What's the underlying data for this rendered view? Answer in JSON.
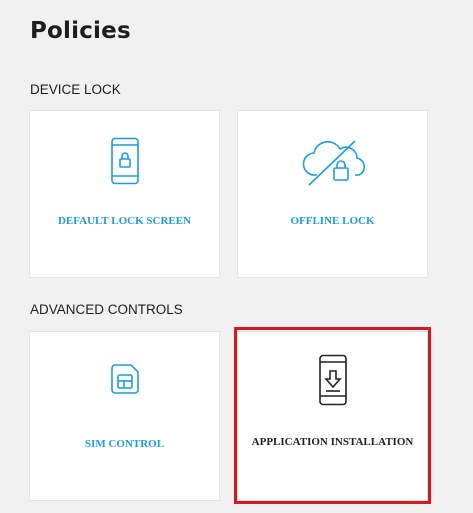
{
  "page": {
    "title": "Policies"
  },
  "sections": [
    {
      "title": "DEVICE LOCK",
      "tiles": [
        {
          "label": "DEFAULT LOCK SCREEN",
          "icon": "phone-lock-icon",
          "color": "#1c9be6"
        },
        {
          "label": "OFFLINE LOCK",
          "icon": "cloud-offline-lock-icon",
          "color": "#1c9be6"
        }
      ]
    },
    {
      "title": "ADVANCED CONTROLS",
      "tiles": [
        {
          "label": "SIM CONTROL",
          "icon": "sim-card-icon",
          "color": "#1c9be6"
        },
        {
          "label": "APPLICATION INSTALLATION",
          "icon": "phone-download-icon",
          "color": "#222222",
          "selected": true
        }
      ]
    }
  ],
  "colors": {
    "accent": "#1c9be6",
    "selection": "#d8181f",
    "background": "#f1f1f1"
  }
}
